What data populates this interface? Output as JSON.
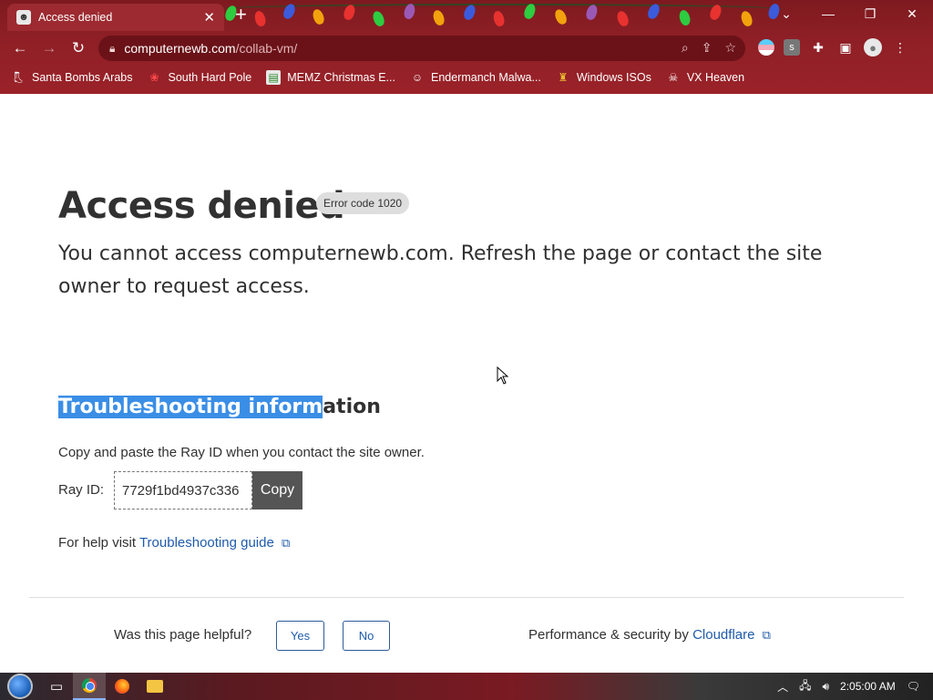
{
  "browser": {
    "tab_title": "Access denied",
    "url_domain": "computernewb.com",
    "url_path": "/collab-vm/",
    "bookmarks": [
      {
        "label": "Santa Bombs Arabs",
        "icon": "boot-icon"
      },
      {
        "label": "South Hard Pole",
        "icon": "cherry-icon"
      },
      {
        "label": "MEMZ Christmas E...",
        "icon": "image-icon"
      },
      {
        "label": "Endermanch Malwa...",
        "icon": "raccoon-icon"
      },
      {
        "label": "Windows ISOs",
        "icon": "trophy-icon"
      },
      {
        "label": "VX Heaven",
        "icon": "skull-icon"
      }
    ],
    "extension_letter": "s"
  },
  "page": {
    "title": "Access denied",
    "error_code": "Error code 1020",
    "subtitle": "You cannot access computernewb.com. Refresh the page or contact the site owner to request access.",
    "troubleshoot_selected": "Troubleshooting inform",
    "troubleshoot_rest": "ation",
    "copy_note": "Copy and paste the Ray ID when you contact the site owner.",
    "ray_label": "Ray ID:",
    "ray_id": "7729f1bd4937c336",
    "copy_label": "Copy",
    "help_prefix": "For help visit",
    "help_link": "Troubleshooting guide",
    "helpful_question": "Was this page helpful?",
    "yes_label": "Yes",
    "no_label": "No",
    "perf_prefix": "Performance & security by",
    "perf_link": "Cloudflare"
  },
  "taskbar": {
    "clock": "2:05:00 AM"
  },
  "colors": {
    "chrome_theme": "#8e1f26",
    "link": "#1f5bab",
    "selection": "#3a8ee6"
  }
}
